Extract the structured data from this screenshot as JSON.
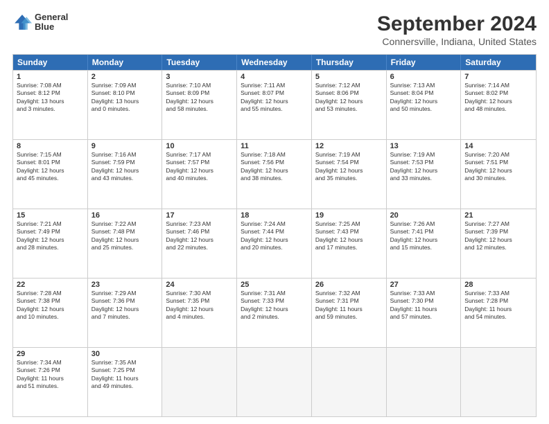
{
  "header": {
    "logo_line1": "General",
    "logo_line2": "Blue",
    "title": "September 2024",
    "subtitle": "Connersville, Indiana, United States"
  },
  "weekdays": [
    "Sunday",
    "Monday",
    "Tuesday",
    "Wednesday",
    "Thursday",
    "Friday",
    "Saturday"
  ],
  "weeks": [
    [
      {
        "day": "1",
        "info": "Sunrise: 7:08 AM\nSunset: 8:12 PM\nDaylight: 13 hours\nand 3 minutes."
      },
      {
        "day": "2",
        "info": "Sunrise: 7:09 AM\nSunset: 8:10 PM\nDaylight: 13 hours\nand 0 minutes."
      },
      {
        "day": "3",
        "info": "Sunrise: 7:10 AM\nSunset: 8:09 PM\nDaylight: 12 hours\nand 58 minutes."
      },
      {
        "day": "4",
        "info": "Sunrise: 7:11 AM\nSunset: 8:07 PM\nDaylight: 12 hours\nand 55 minutes."
      },
      {
        "day": "5",
        "info": "Sunrise: 7:12 AM\nSunset: 8:06 PM\nDaylight: 12 hours\nand 53 minutes."
      },
      {
        "day": "6",
        "info": "Sunrise: 7:13 AM\nSunset: 8:04 PM\nDaylight: 12 hours\nand 50 minutes."
      },
      {
        "day": "7",
        "info": "Sunrise: 7:14 AM\nSunset: 8:02 PM\nDaylight: 12 hours\nand 48 minutes."
      }
    ],
    [
      {
        "day": "8",
        "info": "Sunrise: 7:15 AM\nSunset: 8:01 PM\nDaylight: 12 hours\nand 45 minutes."
      },
      {
        "day": "9",
        "info": "Sunrise: 7:16 AM\nSunset: 7:59 PM\nDaylight: 12 hours\nand 43 minutes."
      },
      {
        "day": "10",
        "info": "Sunrise: 7:17 AM\nSunset: 7:57 PM\nDaylight: 12 hours\nand 40 minutes."
      },
      {
        "day": "11",
        "info": "Sunrise: 7:18 AM\nSunset: 7:56 PM\nDaylight: 12 hours\nand 38 minutes."
      },
      {
        "day": "12",
        "info": "Sunrise: 7:19 AM\nSunset: 7:54 PM\nDaylight: 12 hours\nand 35 minutes."
      },
      {
        "day": "13",
        "info": "Sunrise: 7:19 AM\nSunset: 7:53 PM\nDaylight: 12 hours\nand 33 minutes."
      },
      {
        "day": "14",
        "info": "Sunrise: 7:20 AM\nSunset: 7:51 PM\nDaylight: 12 hours\nand 30 minutes."
      }
    ],
    [
      {
        "day": "15",
        "info": "Sunrise: 7:21 AM\nSunset: 7:49 PM\nDaylight: 12 hours\nand 28 minutes."
      },
      {
        "day": "16",
        "info": "Sunrise: 7:22 AM\nSunset: 7:48 PM\nDaylight: 12 hours\nand 25 minutes."
      },
      {
        "day": "17",
        "info": "Sunrise: 7:23 AM\nSunset: 7:46 PM\nDaylight: 12 hours\nand 22 minutes."
      },
      {
        "day": "18",
        "info": "Sunrise: 7:24 AM\nSunset: 7:44 PM\nDaylight: 12 hours\nand 20 minutes."
      },
      {
        "day": "19",
        "info": "Sunrise: 7:25 AM\nSunset: 7:43 PM\nDaylight: 12 hours\nand 17 minutes."
      },
      {
        "day": "20",
        "info": "Sunrise: 7:26 AM\nSunset: 7:41 PM\nDaylight: 12 hours\nand 15 minutes."
      },
      {
        "day": "21",
        "info": "Sunrise: 7:27 AM\nSunset: 7:39 PM\nDaylight: 12 hours\nand 12 minutes."
      }
    ],
    [
      {
        "day": "22",
        "info": "Sunrise: 7:28 AM\nSunset: 7:38 PM\nDaylight: 12 hours\nand 10 minutes."
      },
      {
        "day": "23",
        "info": "Sunrise: 7:29 AM\nSunset: 7:36 PM\nDaylight: 12 hours\nand 7 minutes."
      },
      {
        "day": "24",
        "info": "Sunrise: 7:30 AM\nSunset: 7:35 PM\nDaylight: 12 hours\nand 4 minutes."
      },
      {
        "day": "25",
        "info": "Sunrise: 7:31 AM\nSunset: 7:33 PM\nDaylight: 12 hours\nand 2 minutes."
      },
      {
        "day": "26",
        "info": "Sunrise: 7:32 AM\nSunset: 7:31 PM\nDaylight: 11 hours\nand 59 minutes."
      },
      {
        "day": "27",
        "info": "Sunrise: 7:33 AM\nSunset: 7:30 PM\nDaylight: 11 hours\nand 57 minutes."
      },
      {
        "day": "28",
        "info": "Sunrise: 7:33 AM\nSunset: 7:28 PM\nDaylight: 11 hours\nand 54 minutes."
      }
    ],
    [
      {
        "day": "29",
        "info": "Sunrise: 7:34 AM\nSunset: 7:26 PM\nDaylight: 11 hours\nand 51 minutes."
      },
      {
        "day": "30",
        "info": "Sunrise: 7:35 AM\nSunset: 7:25 PM\nDaylight: 11 hours\nand 49 minutes."
      },
      {
        "day": "",
        "info": ""
      },
      {
        "day": "",
        "info": ""
      },
      {
        "day": "",
        "info": ""
      },
      {
        "day": "",
        "info": ""
      },
      {
        "day": "",
        "info": ""
      }
    ]
  ]
}
